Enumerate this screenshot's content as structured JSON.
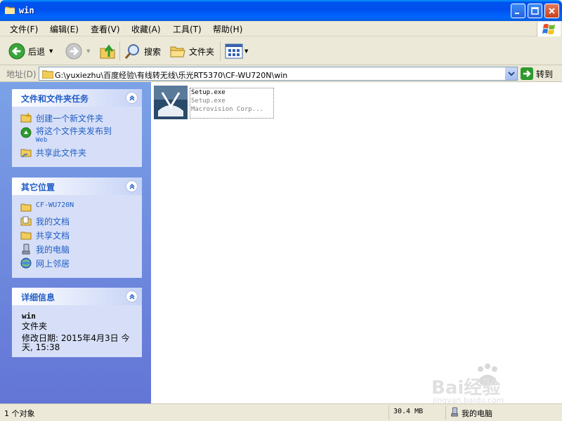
{
  "window": {
    "title": "win"
  },
  "menu": [
    "文件(F)",
    "编辑(E)",
    "查看(V)",
    "收藏(A)",
    "工具(T)",
    "帮助(H)"
  ],
  "toolbar": {
    "back": "后退",
    "search": "搜索",
    "folders": "文件夹"
  },
  "address": {
    "label": "地址(D)",
    "path": "G:\\yuxiezhu\\百度经验\\有线转无线\\乐光RT5370\\CF-WU720N\\win",
    "go": "转到"
  },
  "tasks_panel": {
    "title": "文件和文件夹任务",
    "items": [
      {
        "label": "创建一个新文件夹",
        "icon": "new-folder-icon"
      },
      {
        "label": "将这个文件夹发布到",
        "sub": "Web",
        "icon": "publish-web-icon"
      },
      {
        "label": "共享此文件夹",
        "icon": "share-folder-icon"
      }
    ]
  },
  "places_panel": {
    "title": "其它位置",
    "items": [
      {
        "label": "CF-WU720N",
        "icon": "folder-icon"
      },
      {
        "label": "我的文档",
        "icon": "my-documents-icon"
      },
      {
        "label": "共享文档",
        "icon": "shared-documents-icon"
      },
      {
        "label": "我的电脑",
        "icon": "my-computer-icon"
      },
      {
        "label": "网上邻居",
        "icon": "network-icon"
      }
    ]
  },
  "details_panel": {
    "title": "详细信息",
    "name": "win",
    "type": "文件夹",
    "modified_line1": "修改日期: 2015年4月3日 今",
    "modified_line2": "天, 15:38"
  },
  "files": [
    {
      "name": "Setup.exe",
      "description": "Setup.exe",
      "company": "Macrovision Corp...",
      "icon": "installer-icon"
    }
  ],
  "status": {
    "count": "1 个对象",
    "size": "30.4 MB",
    "location": "我的电脑"
  },
  "watermark": {
    "text": "Bai经验",
    "url": "jingyan.baidu.com"
  },
  "colors": {
    "titlebar": "#0053ee",
    "task_link": "#215dc6",
    "pane_bg": "#6375d6"
  }
}
